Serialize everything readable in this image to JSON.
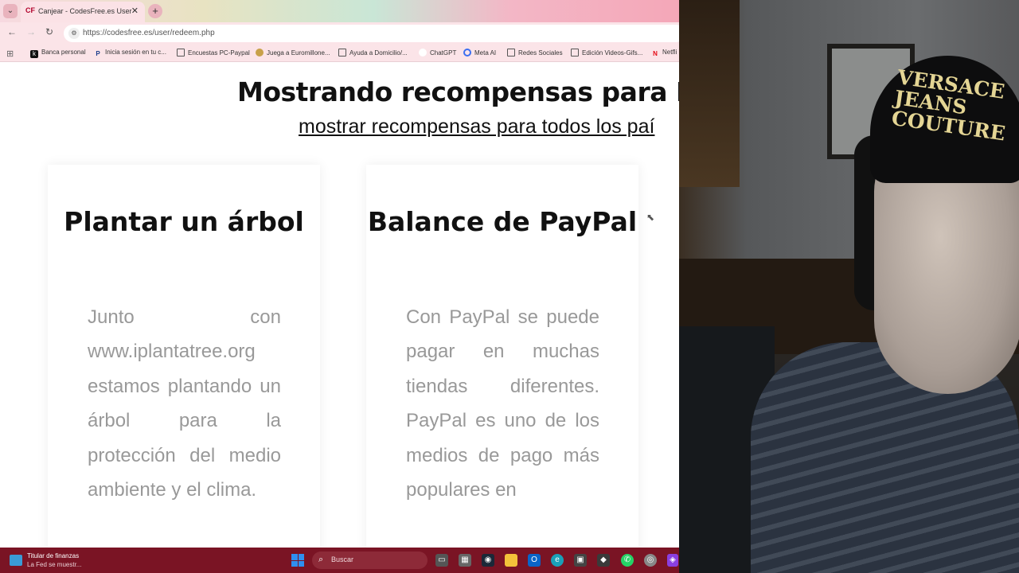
{
  "browser": {
    "tab": {
      "favicon": "CF",
      "title": "Canjear - CodesFree.es User",
      "close": "✕"
    },
    "new_tab": "+",
    "url": "https://codesfree.es/user/redeem.php",
    "bookmarks": [
      {
        "label": "Banca personal",
        "icon": "k"
      },
      {
        "label": "Inicia sesión en tu c...",
        "icon": "P"
      },
      {
        "label": "Encuestas PC-Paypal",
        "icon": "folder-icon"
      },
      {
        "label": "Juega a Euromillone...",
        "icon": "globe-icon"
      },
      {
        "label": "Ayuda a Domicilio/...",
        "icon": "folder-icon"
      },
      {
        "label": "ChatGPT",
        "icon": "circle-icon"
      },
      {
        "label": "Meta AI",
        "icon": "meta-icon"
      },
      {
        "label": "Redes Sociales",
        "icon": "folder-icon"
      },
      {
        "label": "Edición Videos-Gifs...",
        "icon": "folder-icon"
      },
      {
        "label": "Netfli",
        "icon": "N"
      }
    ]
  },
  "page": {
    "heading": "Mostrando recompensas para E",
    "all_countries_link": "mostrar recompensas para todos los paí",
    "cards": [
      {
        "title": "Plantar un árbol",
        "description": "Junto con www.iplantatree.org estamos plantando un árbol para la protección del medio ambiente y el clima."
      },
      {
        "title": "Balance de PayPal",
        "description": "Con PayPal se puede pagar en muchas tiendas diferentes. PayPal es uno de los medios de pago más populares en"
      }
    ]
  },
  "webcam": {
    "cap_text": "VERSACE JEANS COUTURE"
  },
  "taskbar": {
    "news_title": "Titular de finanzas",
    "news_subtitle": "La Fed se muestr...",
    "search_placeholder": "Buscar",
    "pinned_apps": [
      "task-view-icon",
      "calculator-icon",
      "steam-icon",
      "file-explorer-icon",
      "outlook-icon",
      "edge-icon",
      "store-icon",
      "game-icon",
      "whatsapp-icon",
      "chrome-icon",
      "app-icon"
    ]
  },
  "colors": {
    "taskbar": "#7a1424",
    "card_text": "#999999",
    "heading": "#111111"
  }
}
